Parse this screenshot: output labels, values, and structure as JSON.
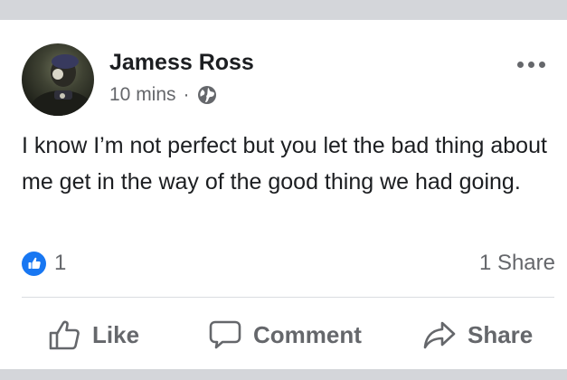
{
  "post": {
    "author": "Jamess Ross",
    "time": "10 mins",
    "separator": "·",
    "privacy_icon": "globe-icon",
    "text": "I know I’m not perfect but you let the bad thing about me get in the way of the good thing we had going.",
    "reactions_count": "1",
    "shares": "1 Share"
  },
  "actions": {
    "like": "Like",
    "comment": "Comment",
    "share": "Share"
  },
  "colors": {
    "accent": "#1877f2",
    "secondary_text": "#65676b",
    "primary_text": "#1c1e21",
    "band": "#d4d6da"
  }
}
